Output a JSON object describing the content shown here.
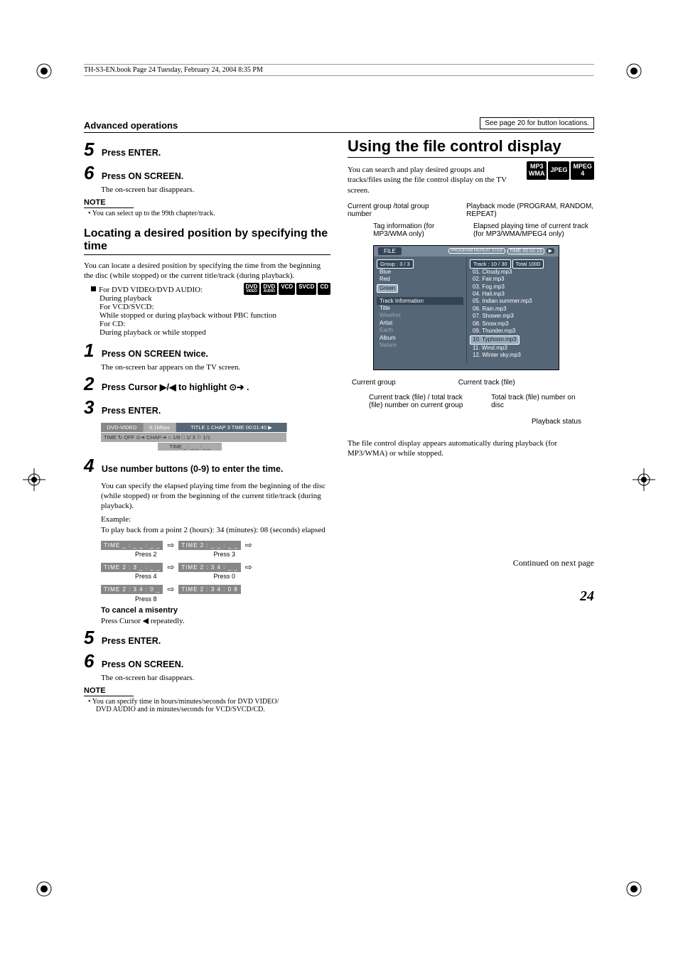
{
  "headerLine": "TH-S3-EN.book  Page 24  Tuesday, February 24, 2004  8:35 PM",
  "headerTitle": "Advanced operations",
  "headerNote": "See page 20 for button locations.",
  "left": {
    "step5": "Press ENTER.",
    "step6": "Press ON SCREEN.",
    "step6sub": "The on-screen bar disappears.",
    "noteHead": "NOTE",
    "note1": "You can select up to the 99th chapter/track.",
    "secTitle": "Locating a desired position by specifying the time",
    "secBody": "You can locate a desired position by specifying the time from the beginning the disc (while stopped) or the current title/track (during playback).",
    "forDvd": "For DVD VIDEO/DVD AUDIO:",
    "forDvdSub": "During playback",
    "forVcd": "For VCD/SVCD:",
    "forVcdSub": "While stopped or during playback without PBC function",
    "forCd": "For CD:",
    "forCdSub": "During playback or while stopped",
    "s1": "Press ON SCREEN twice.",
    "s1sub": "The on-screen bar appears on the TV screen.",
    "s2": "Press Cursor ▶/◀ to highlight ⊙➔ .",
    "s3": "Press ENTER.",
    "bar1a": "DVD-VIDEO",
    "bar1b": "6.1Mbps",
    "bar1c": "TITLE  1  CHAP  3  TIME 00:01:40  ▶",
    "bar2": "TIME ↻ OFF   ⊙➔  CHAP.➔  ○ 1/8  □ 1/ 3  ⚐ 1/1",
    "bar3": "TIME   _ : _ _ : _ _",
    "s4": "Use number buttons (0-9) to enter the time.",
    "s4body": "You can specify the elapsed playing time from the beginning of the disc (while stopped) or from the beginning of the current title/track (during playback).",
    "example": "Example:",
    "exampleSub": "To play back from a point 2 (hours): 34 (minutes): 08 (seconds) elapsed",
    "t1a": "TIME   _ : _ _ : _ _",
    "p2": "Press 2",
    "t1b": "TIME   2 : _ _ : _ _",
    "p3": "Press 3",
    "t2a": "TIME   2 : 3 _ : _ _",
    "p4": "Press 4",
    "t2b": "TIME   2 : 3 4 : _ _",
    "p0": "Press 0",
    "t3a": "TIME   2 : 3 4 : 0 _",
    "p8": "Press 8",
    "t3b": "TIME   2 : 3 4 : 0 8",
    "cancel": "To cancel a misentry",
    "cancelSub": "Press Cursor ◀ repeatedly.",
    "s5": "Press ENTER.",
    "s6": "Press ON SCREEN.",
    "s6sub": "The on-screen bar disappears.",
    "note2a": "You can specify time in hours/minutes/seconds for DVD VIDEO/",
    "note2b": "DVD AUDIO and in minutes/seconds for VCD/SVCD/CD."
  },
  "right": {
    "heading": "Using the file control display",
    "intro": "You can search and play desired groups and tracks/files using the file control display on the TV screen.",
    "badges": {
      "a": "MP3",
      "a2": "WMA",
      "b": "JPEG",
      "c": "MPEG",
      "c2": "4"
    },
    "lbl_curgrouptotal": "Current group /total group number",
    "lbl_pbmode": "Playback mode (PROGRAM, RANDOM, REPEAT)",
    "lbl_taginfo": "Tag information (for MP3/WMA only)",
    "lbl_elapsed": "Elapsed playing time of current track (for MP3/WMA/MPEG4 only)",
    "lbl_curgroup": "Current group",
    "lbl_curtrack": "Current track (file)",
    "lbl_curtracktotal": "Current track (file) / total track (file) number on current group",
    "lbl_totaltrack": "Total track (file) number on disc",
    "lbl_pbstatus": "Playback status",
    "display": {
      "file": "FILE",
      "modes": "PROGRAM REPEAT STEP",
      "time": "TIME 00:02:15",
      "groupHead": "Group  :   3 / 3",
      "trackHead": "Track  :  10  /  30",
      "totalHead": "Total   1000",
      "groups": [
        "Blue",
        "Red",
        "Green"
      ],
      "tracks": [
        "01. Cloudy.mp3",
        "02. Fair.mp3",
        "03. Fog.mp3",
        "04. Hail.mp3",
        "05. Indian summer.mp3",
        "06. Rain.mp3",
        "07. Shower.mp3",
        "08. Snow.mp3",
        "09. Thunder.mp3",
        "10. Typhoon.mp3",
        "11. Wind.mp3",
        "12. Winter sky.mp3"
      ],
      "infoHead": "Track  Information",
      "info": [
        "Title",
        "Weather",
        "Artist",
        "Earth",
        "Album",
        "Nature"
      ]
    },
    "outro": "The file control display appears automatically during playback (for MP3/WMA) or while stopped.",
    "cont": "Continued on next page",
    "pageNum": "24"
  },
  "discs": {
    "dvdv": "DVD",
    "dvdv2": "VIDEO",
    "dvda": "DVD",
    "dvda2": "AUDIO",
    "vcd": "VCD",
    "svcd": "SVCD",
    "cd": "CD"
  }
}
